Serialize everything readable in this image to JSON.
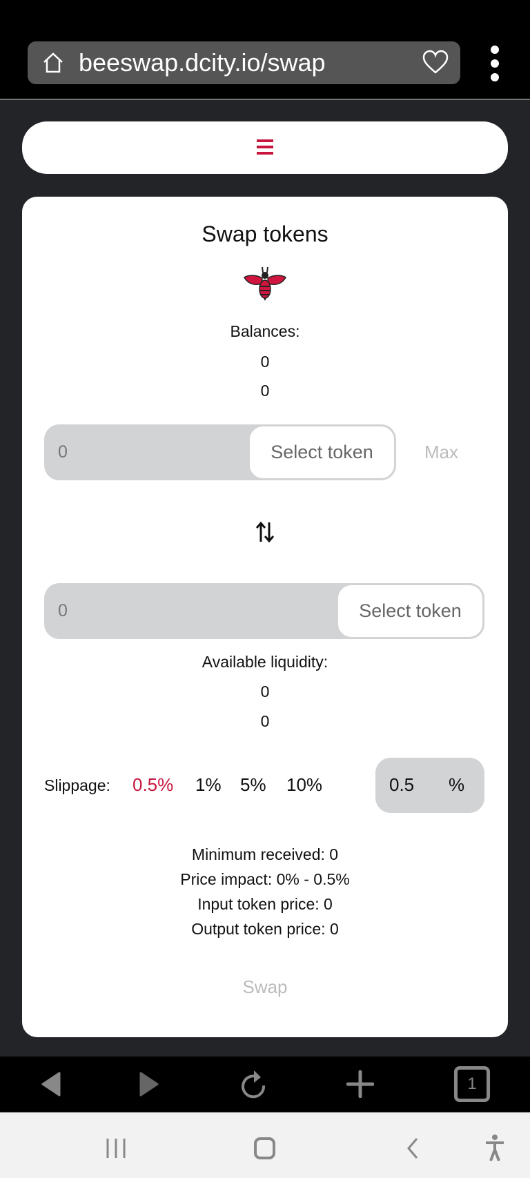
{
  "browser": {
    "url": "beeswap.dcity.io/swap",
    "tab_count": "1"
  },
  "colors": {
    "accent": "#c8173f",
    "field_bg": "#d2d3d5",
    "page_bg": "#222428"
  },
  "header": {
    "menu_icon": "hamburger-icon"
  },
  "swap": {
    "title": "Swap tokens",
    "balances_label": "Balances:",
    "balances": [
      "0",
      "0"
    ],
    "input": {
      "value": "0",
      "select_label": "Select token",
      "max_label": "Max"
    },
    "output": {
      "value": "0",
      "select_label": "Select token"
    },
    "liquidity_label": "Available liquidity:",
    "liquidity": [
      "0",
      "0"
    ],
    "slippage": {
      "label": "Slippage:",
      "options": [
        "0.5%",
        "1%",
        "5%",
        "10%"
      ],
      "selected": "0.5%",
      "custom_value": "0.5",
      "custom_unit": "%"
    },
    "info": [
      "Minimum received: 0",
      "Price impact: 0% - 0.5%",
      "Input token price: 0",
      "Output token price: 0"
    ],
    "swap_label": "Swap"
  }
}
